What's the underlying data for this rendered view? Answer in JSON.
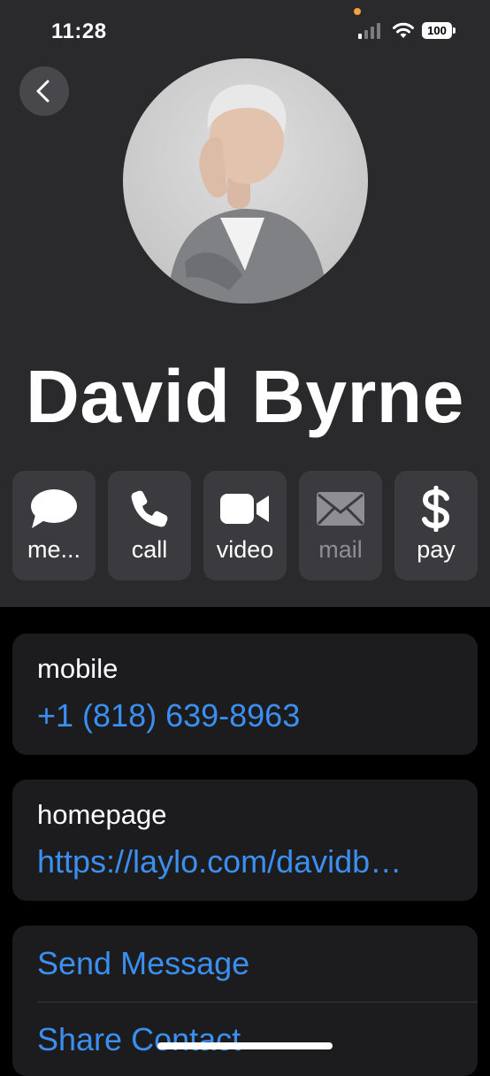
{
  "status_bar": {
    "time": "11:28",
    "battery": "100"
  },
  "contact": {
    "name": "David Byrne"
  },
  "actions": [
    {
      "label": "me...",
      "icon": "message-bubble-icon",
      "enabled": true
    },
    {
      "label": "call",
      "icon": "phone-icon",
      "enabled": true
    },
    {
      "label": "video",
      "icon": "video-camera-icon",
      "enabled": true
    },
    {
      "label": "mail",
      "icon": "envelope-icon",
      "enabled": false
    },
    {
      "label": "pay",
      "icon": "dollar-icon",
      "enabled": true
    }
  ],
  "phone": {
    "label": "mobile",
    "value": "+1 (818) 639-8963"
  },
  "homepage": {
    "label": "homepage",
    "value": "https://laylo.com/davidb…"
  },
  "options": {
    "send_message": "Send Message",
    "share_contact": "Share Contact"
  },
  "colors": {
    "accent": "#3a8ff0",
    "header_bg": "#2a2a2d",
    "card_bg": "#1c1c1e",
    "button_bg": "#3b3b3f"
  }
}
